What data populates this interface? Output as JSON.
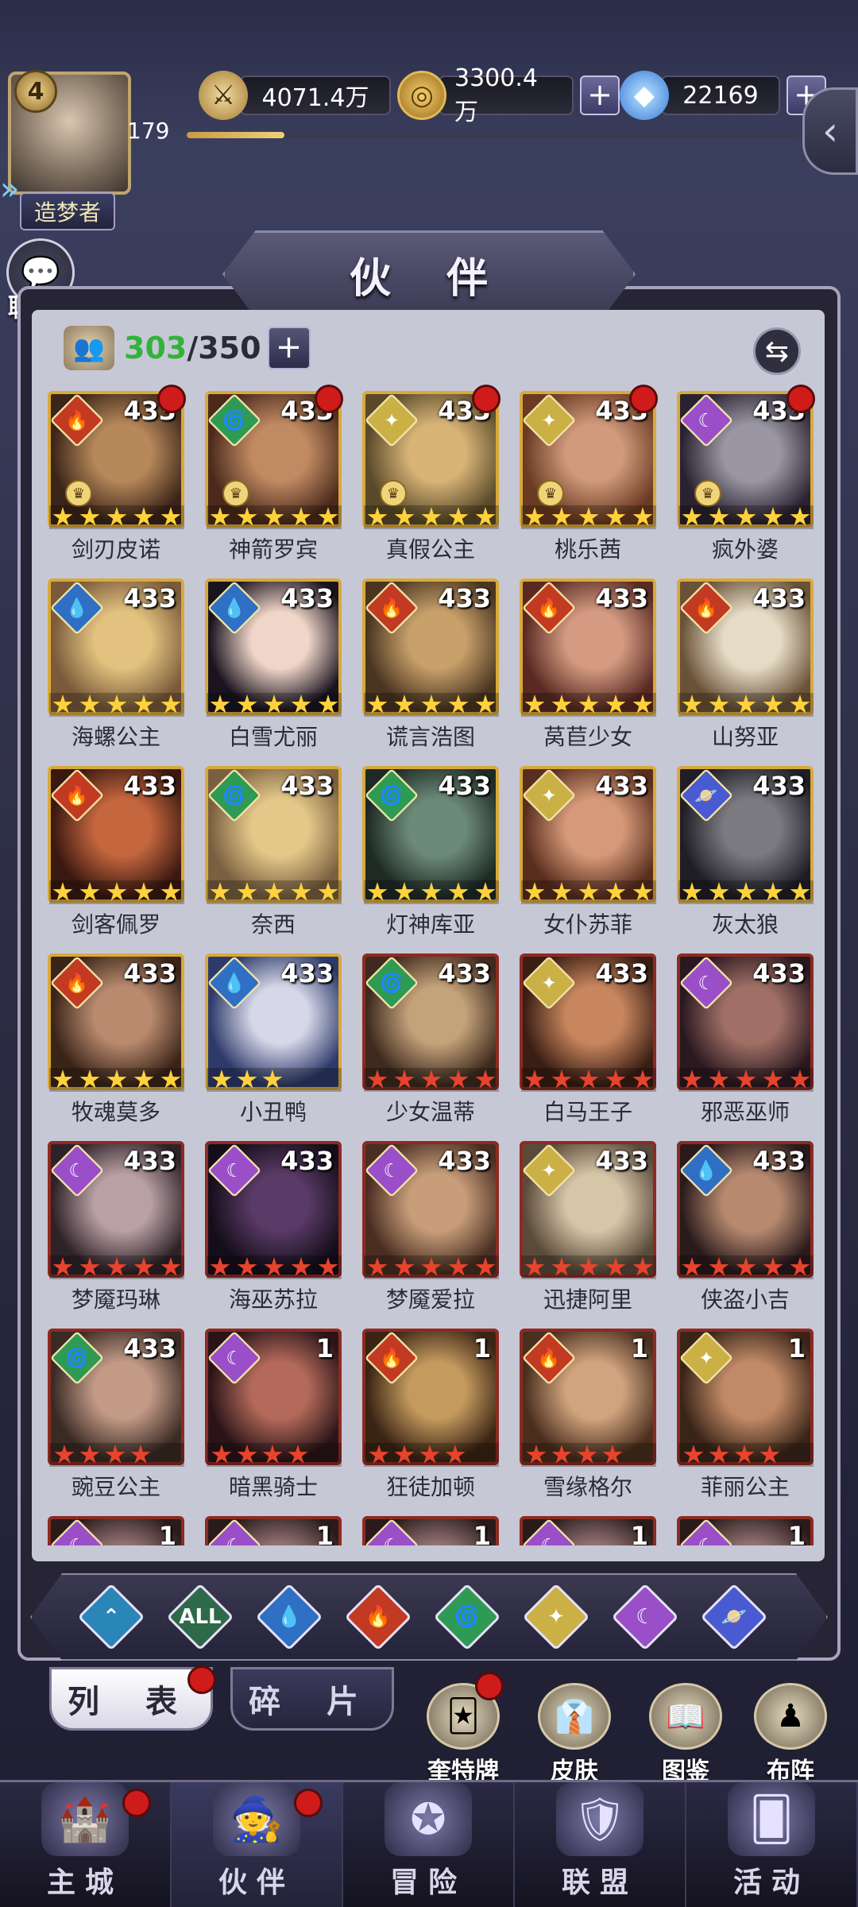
{
  "resources": {
    "power": "4071.4万",
    "gold": "3300.4万",
    "gems": "22169"
  },
  "player": {
    "level": "4",
    "exp_value": "179",
    "exp_progress": 0.16,
    "title": "造梦者"
  },
  "chat_label": "聊 天",
  "panel_title": "伙 伴",
  "count": {
    "current": "303",
    "max": "/350"
  },
  "heroes": [
    {
      "name": "剑刃皮诺",
      "level": "433",
      "element": "fire",
      "stars": "gold",
      "dot": true,
      "crown": true,
      "c1": "#b7885a",
      "c2": "#3b2418"
    },
    {
      "name": "神箭罗宾",
      "level": "433",
      "element": "wind",
      "stars": "gold",
      "dot": true,
      "crown": true,
      "c1": "#c08a62",
      "c2": "#4b2a1c"
    },
    {
      "name": "真假公主",
      "level": "433",
      "element": "light",
      "stars": "gold",
      "dot": true,
      "crown": true,
      "c1": "#d8b477",
      "c2": "#5a4a2a"
    },
    {
      "name": "桃乐茜",
      "level": "433",
      "element": "light",
      "stars": "gold",
      "dot": true,
      "crown": true,
      "c1": "#d09a7b",
      "c2": "#6a3a22"
    },
    {
      "name": "疯外婆",
      "level": "433",
      "element": "dark",
      "stars": "gold",
      "dot": true,
      "crown": true,
      "c1": "#9a96a4",
      "c2": "#2a2230"
    },
    {
      "name": "海螺公主",
      "level": "433",
      "element": "water",
      "stars": "gold",
      "dot": false,
      "crown": false,
      "c1": "#e2c27e",
      "c2": "#7a5a3a"
    },
    {
      "name": "白雪尤丽",
      "level": "433",
      "element": "water",
      "stars": "gold",
      "dot": false,
      "crown": false,
      "c1": "#f0d6c8",
      "c2": "#1a1420"
    },
    {
      "name": "谎言浩图",
      "level": "433",
      "element": "fire",
      "stars": "gold",
      "dot": false,
      "crown": false,
      "c1": "#c8a06a",
      "c2": "#4a3520"
    },
    {
      "name": "莴苣少女",
      "level": "433",
      "element": "fire",
      "stars": "gold",
      "dot": false,
      "crown": false,
      "c1": "#d49b82",
      "c2": "#5a2a22"
    },
    {
      "name": "山努亚",
      "level": "433",
      "element": "fire",
      "stars": "gold",
      "dot": false,
      "crown": false,
      "c1": "#e6dcc6",
      "c2": "#6a5238"
    },
    {
      "name": "剑客佩罗",
      "level": "433",
      "element": "fire",
      "stars": "gold",
      "dot": false,
      "crown": false,
      "c1": "#c4663e",
      "c2": "#3a1810"
    },
    {
      "name": "奈西",
      "level": "433",
      "element": "wind",
      "stars": "gold",
      "dot": false,
      "crown": false,
      "c1": "#e4c88a",
      "c2": "#7a6040"
    },
    {
      "name": "灯神库亚",
      "level": "433",
      "element": "wind",
      "stars": "gold",
      "dot": false,
      "crown": false,
      "c1": "#6c8a78",
      "c2": "#1e2a24"
    },
    {
      "name": "女仆苏菲",
      "level": "433",
      "element": "light",
      "stars": "gold",
      "dot": false,
      "crown": false,
      "c1": "#d69a7a",
      "c2": "#5a2e1e"
    },
    {
      "name": "灰太狼",
      "level": "433",
      "element": "space",
      "stars": "gold",
      "dot": false,
      "crown": false,
      "c1": "#7a7a80",
      "c2": "#1e1e24"
    },
    {
      "name": "牧魂莫多",
      "level": "433",
      "element": "fire",
      "stars": "gold",
      "dot": false,
      "crown": false,
      "c1": "#b98a6e",
      "c2": "#3a2418"
    },
    {
      "name": "小丑鸭",
      "level": "433",
      "element": "water",
      "stars": "gold3",
      "dot": false,
      "crown": false,
      "c1": "#d6d8e8",
      "c2": "#2e3a6a"
    },
    {
      "name": "少女温蒂",
      "level": "433",
      "element": "wind",
      "stars": "red",
      "dot": false,
      "crown": false,
      "c1": "#c4a27a",
      "c2": "#3e2a1e"
    },
    {
      "name": "白马王子",
      "level": "433",
      "element": "light",
      "stars": "red",
      "dot": false,
      "crown": false,
      "c1": "#c8865e",
      "c2": "#3a1e14"
    },
    {
      "name": "邪恶巫师",
      "level": "433",
      "element": "dark",
      "stars": "red",
      "dot": false,
      "crown": false,
      "c1": "#a07066",
      "c2": "#2a1820"
    },
    {
      "name": "梦魇玛琳",
      "level": "433",
      "element": "dark",
      "stars": "red",
      "dot": false,
      "crown": false,
      "c1": "#b8a0a4",
      "c2": "#2e2228"
    },
    {
      "name": "海巫苏拉",
      "level": "433",
      "element": "dark",
      "stars": "red",
      "dot": false,
      "crown": false,
      "c1": "#5a3a66",
      "c2": "#140e1a"
    },
    {
      "name": "梦魇爱拉",
      "level": "433",
      "element": "dark",
      "stars": "red",
      "dot": false,
      "crown": false,
      "c1": "#c89e7a",
      "c2": "#4a2e22"
    },
    {
      "name": "迅捷阿里",
      "level": "433",
      "element": "light",
      "stars": "red",
      "dot": false,
      "crown": false,
      "c1": "#d6c6a8",
      "c2": "#5a4a3a"
    },
    {
      "name": "侠盗小吉",
      "level": "433",
      "element": "water",
      "stars": "red",
      "dot": false,
      "crown": false,
      "c1": "#b78a70",
      "c2": "#2a1a1c"
    },
    {
      "name": "豌豆公主",
      "level": "433",
      "element": "wind",
      "stars": "red4",
      "dot": false,
      "crown": false,
      "c1": "#c29a86",
      "c2": "#3a2a24"
    },
    {
      "name": "暗黑骑士",
      "level": "1",
      "element": "dark",
      "stars": "red4",
      "dot": false,
      "crown": false,
      "c1": "#b36a5a",
      "c2": "#2a1418"
    },
    {
      "name": "狂徒加顿",
      "level": "1",
      "element": "fire",
      "stars": "red4",
      "dot": false,
      "crown": false,
      "c1": "#c49a5e",
      "c2": "#3a2414"
    },
    {
      "name": "雪缘格尔",
      "level": "1",
      "element": "fire",
      "stars": "red4",
      "dot": false,
      "crown": false,
      "c1": "#d0a47e",
      "c2": "#4a2e1e"
    },
    {
      "name": "菲丽公主",
      "level": "1",
      "element": "light",
      "stars": "red4",
      "dot": false,
      "crown": false,
      "c1": "#c08a66",
      "c2": "#3a2418"
    },
    {
      "name": "",
      "level": "1",
      "element": "dark",
      "stars": "red4",
      "dot": false,
      "crown": false,
      "c1": "#a08080",
      "c2": "#2a1a1a"
    },
    {
      "name": "",
      "level": "1",
      "element": "dark",
      "stars": "red4",
      "dot": false,
      "crown": false,
      "c1": "#a08080",
      "c2": "#2a1a1a"
    },
    {
      "name": "",
      "level": "1",
      "element": "dark",
      "stars": "red4",
      "dot": false,
      "crown": false,
      "c1": "#a08080",
      "c2": "#2a1a1a"
    },
    {
      "name": "",
      "level": "1",
      "element": "dark",
      "stars": "red4",
      "dot": false,
      "crown": false,
      "c1": "#a08080",
      "c2": "#2a1a1a"
    },
    {
      "name": "",
      "level": "1",
      "element": "dark",
      "stars": "red4",
      "dot": false,
      "crown": false,
      "c1": "#a08080",
      "c2": "#2a1a1a"
    }
  ],
  "filters": [
    {
      "id": "basic",
      "label": "",
      "color": "#2a86b8",
      "glyph": "⌃"
    },
    {
      "id": "all",
      "label": "ALL",
      "color": "#2e6a4a",
      "glyph": ""
    },
    {
      "id": "water",
      "label": "",
      "color": "#2f6fc4",
      "glyph": "💧"
    },
    {
      "id": "fire",
      "label": "",
      "color": "#c23a22",
      "glyph": "🔥"
    },
    {
      "id": "wind",
      "label": "",
      "color": "#2e9a54",
      "glyph": "🌀"
    },
    {
      "id": "light",
      "label": "",
      "color": "#cbb046",
      "glyph": "✦"
    },
    {
      "id": "dark",
      "label": "",
      "color": "#9a4ec8",
      "glyph": "☾"
    },
    {
      "id": "space",
      "label": "",
      "color": "#4a5ad0",
      "glyph": "🪐"
    }
  ],
  "subtabs": {
    "list": "列 表",
    "fragments": "碎 片"
  },
  "features": [
    {
      "id": "cards",
      "label": "奎特牌",
      "glyph": "🃏"
    },
    {
      "id": "skin",
      "label": "皮肤",
      "glyph": "👔"
    },
    {
      "id": "codex",
      "label": "图鉴",
      "glyph": "📖"
    },
    {
      "id": "formation",
      "label": "布阵",
      "glyph": "♟"
    }
  ],
  "nav": [
    {
      "id": "city",
      "label": "主城",
      "glyph": "🏰",
      "dot": true,
      "active": false
    },
    {
      "id": "partner",
      "label": "伙伴",
      "glyph": "🧙",
      "dot": true,
      "active": true
    },
    {
      "id": "adventure",
      "label": "冒险",
      "glyph": "✪",
      "dot": false,
      "active": false
    },
    {
      "id": "alliance",
      "label": "联盟",
      "glyph": "🛡",
      "dot": false,
      "active": false
    },
    {
      "id": "activity",
      "label": "活动",
      "glyph": "🂠",
      "dot": false,
      "active": false
    }
  ],
  "colors": {
    "water": "#2f6fc4",
    "fire": "#c23a22",
    "wind": "#2e9a54",
    "light": "#cbb046",
    "dark": "#9a4ec8",
    "space": "#4a5ad0"
  }
}
